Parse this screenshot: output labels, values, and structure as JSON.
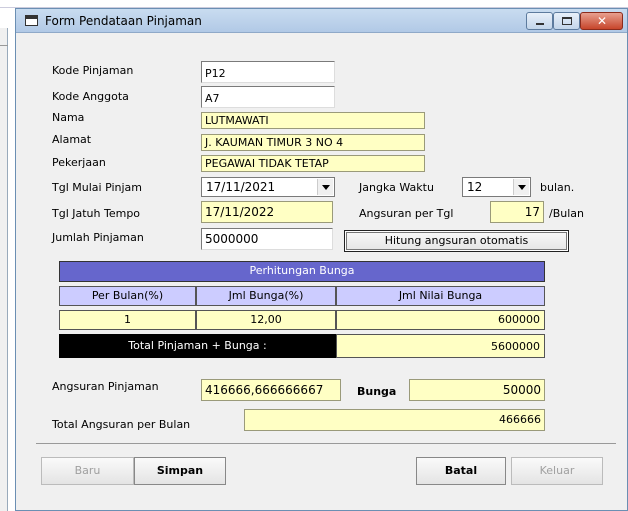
{
  "window": {
    "title": "Form Pendataan Pinjaman"
  },
  "fields": {
    "kode_pinjaman": {
      "label": "Kode Pinjaman",
      "value": "P12"
    },
    "kode_anggota": {
      "label": "Kode Anggota",
      "value": "A7"
    },
    "nama": {
      "label": "Nama",
      "value": "LUTMAWATI"
    },
    "alamat": {
      "label": "Alamat",
      "value": "J. KAUMAN TIMUR 3 NO 4"
    },
    "pekerjaan": {
      "label": "Pekerjaan",
      "value": "PEGAWAI TIDAK TETAP"
    },
    "tgl_mulai": {
      "label": "Tgl Mulai Pinjam",
      "value": "17/11/2021"
    },
    "jangka_waktu": {
      "label": "Jangka Waktu",
      "value": "12",
      "suffix": "bulan."
    },
    "tgl_jatuh_tempo": {
      "label": "Tgl Jatuh Tempo",
      "value": "17/11/2022"
    },
    "angsuran_per_tgl": {
      "label": "Angsuran per Tgl",
      "value": "17",
      "suffix": "/Bulan"
    },
    "jumlah_pinjaman": {
      "label": "Jumlah Pinjaman",
      "value": "5000000"
    }
  },
  "hitung_button": "Hitung angsuran otomatis",
  "bunga_table": {
    "title": "Perhitungan Bunga",
    "columns": [
      "Per Bulan(%)",
      "Jml Bunga(%)",
      "Jml Nilai Bunga"
    ],
    "row": [
      "1",
      "12,00",
      "600000"
    ],
    "total_label": "Total Pinjaman + Bunga :",
    "total_value": "5600000"
  },
  "summary": {
    "angsuran_label": "Angsuran Pinjaman",
    "angsuran_value": "416666,666666667",
    "bunga_label": "Bunga",
    "bunga_value": "50000",
    "total_label": "Total Angsuran per Bulan",
    "total_value": "466666"
  },
  "buttons": {
    "baru": "Baru",
    "simpan": "Simpan",
    "batal": "Batal",
    "keluar": "Keluar"
  },
  "title_buttons": {
    "close_glyph": "✕"
  }
}
